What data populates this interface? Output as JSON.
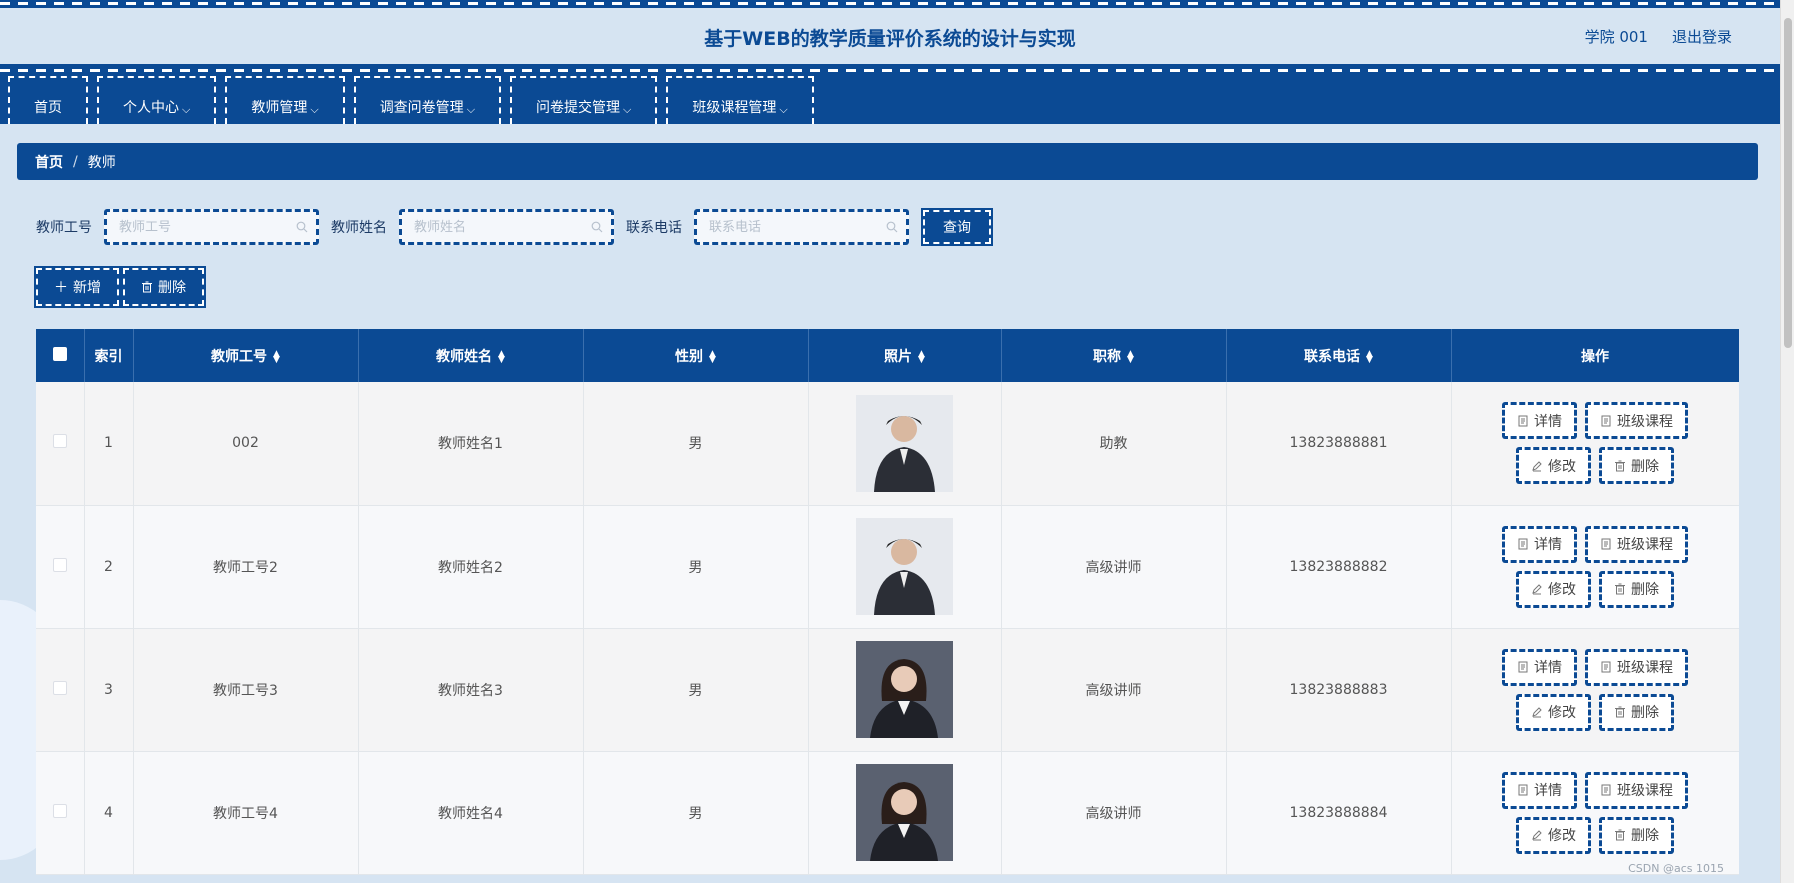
{
  "header": {
    "title": "基于WEB的教学质量评价系统的设计与实现",
    "user": "学院 001",
    "logout": "退出登录"
  },
  "nav": {
    "items": [
      {
        "label": "首页",
        "dropdown": false
      },
      {
        "label": "个人中心",
        "dropdown": true
      },
      {
        "label": "教师管理",
        "dropdown": true
      },
      {
        "label": "调查问卷管理",
        "dropdown": true
      },
      {
        "label": "问卷提交管理",
        "dropdown": true
      },
      {
        "label": "班级课程管理",
        "dropdown": true
      }
    ]
  },
  "breadcrumb": {
    "home": "首页",
    "sep": "/",
    "current": "教师"
  },
  "search": {
    "fields": [
      {
        "label": "教师工号",
        "placeholder": "教师工号",
        "value": ""
      },
      {
        "label": "教师姓名",
        "placeholder": "教师姓名",
        "value": ""
      },
      {
        "label": "联系电话",
        "placeholder": "联系电话",
        "value": ""
      }
    ],
    "button": "查询"
  },
  "actions": {
    "add": "新增",
    "delete": "删除"
  },
  "table": {
    "columns": [
      "索引",
      "教师工号",
      "教师姓名",
      "性别",
      "照片",
      "职称",
      "联系电话",
      "操作"
    ],
    "sortable": [
      false,
      true,
      true,
      true,
      true,
      true,
      true,
      false
    ],
    "rows": [
      {
        "index": "1",
        "id": "002",
        "name": "教师姓名1",
        "gender": "男",
        "photo": "male-teacher-photo",
        "title": "助教",
        "phone": "13823888881"
      },
      {
        "index": "2",
        "id": "教师工号2",
        "name": "教师姓名2",
        "gender": "男",
        "photo": "male-teacher-photo",
        "title": "高级讲师",
        "phone": "13823888882"
      },
      {
        "index": "3",
        "id": "教师工号3",
        "name": "教师姓名3",
        "gender": "男",
        "photo": "female-teacher-photo",
        "title": "高级讲师",
        "phone": "13823888883"
      },
      {
        "index": "4",
        "id": "教师工号4",
        "name": "教师姓名4",
        "gender": "男",
        "photo": "female-teacher-photo",
        "title": "高级讲师",
        "phone": "13823888884"
      }
    ],
    "row_actions": {
      "detail": "详情",
      "course": "班级课程",
      "edit": "修改",
      "delete": "删除"
    }
  },
  "watermark": "CSDN @acs 1015",
  "colors": {
    "primary": "#0b4a94",
    "page_bg": "#d6e4f2"
  }
}
